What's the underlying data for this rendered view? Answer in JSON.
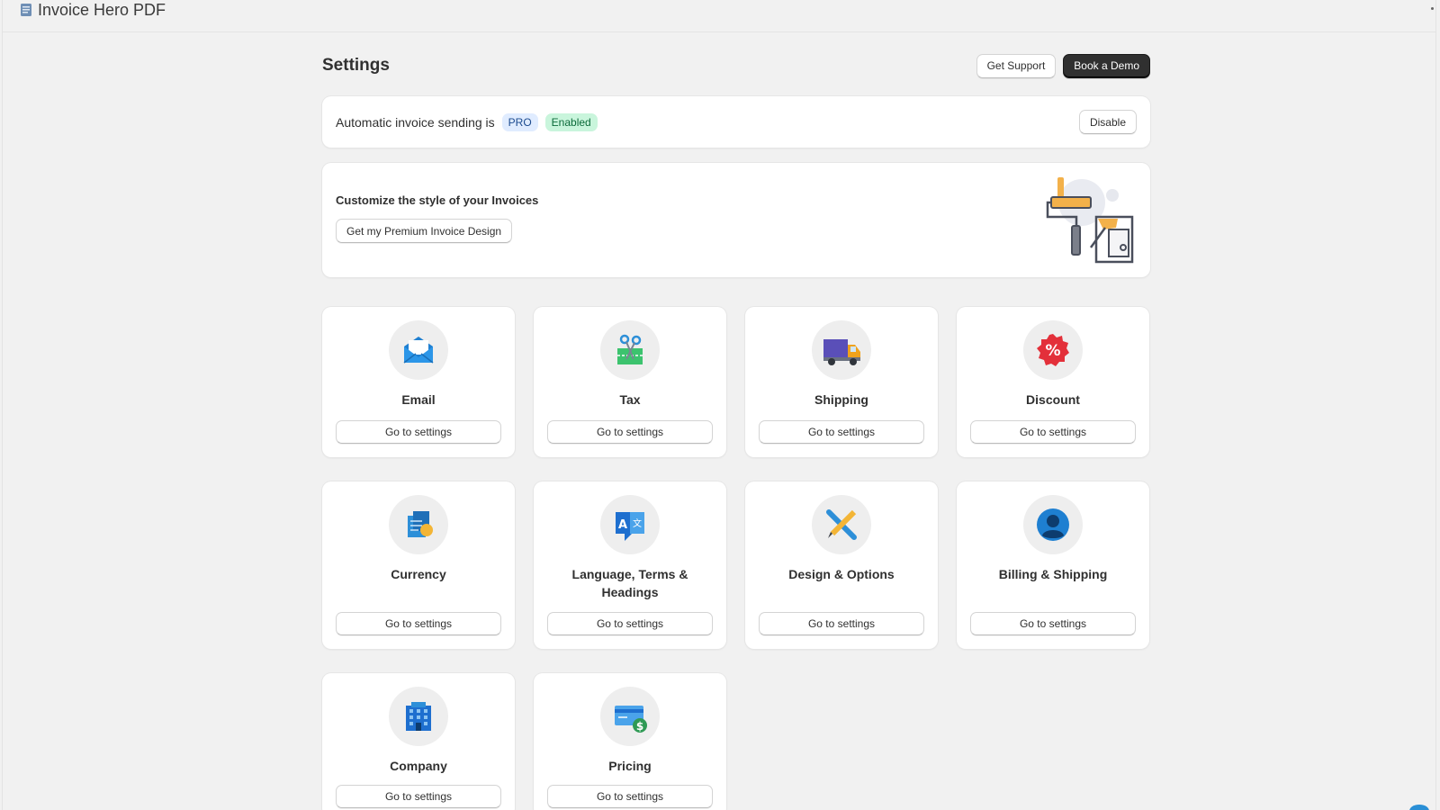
{
  "app": {
    "title": "Invoice Hero PDF"
  },
  "header": {
    "title": "Settings",
    "support_label": "Get Support",
    "demo_label": "Book a Demo"
  },
  "auto_sending": {
    "text": "Automatic invoice sending is",
    "badge_pro": "PRO",
    "badge_status": "Enabled",
    "action_label": "Disable"
  },
  "customize": {
    "title": "Customize the style of your Invoices",
    "button_label": "Get my Premium Invoice Design"
  },
  "tiles": [
    {
      "label": "Email",
      "icon": "email-icon",
      "button": "Go to settings"
    },
    {
      "label": "Tax",
      "icon": "scissors-icon",
      "button": "Go to settings"
    },
    {
      "label": "Shipping",
      "icon": "truck-icon",
      "button": "Go to settings"
    },
    {
      "label": "Discount",
      "icon": "percent-icon",
      "button": "Go to settings"
    },
    {
      "label": "Currency",
      "icon": "currency-icon",
      "button": "Go to settings"
    },
    {
      "label": "Language, Terms & Headings",
      "icon": "translate-icon",
      "button": "Go to settings"
    },
    {
      "label": "Design & Options",
      "icon": "design-tools-icon",
      "button": "Go to settings"
    },
    {
      "label": "Billing & Shipping",
      "icon": "user-icon",
      "button": "Go to settings"
    },
    {
      "label": "Company",
      "icon": "building-icon",
      "button": "Go to settings"
    },
    {
      "label": "Pricing",
      "icon": "card-dollar-icon",
      "button": "Go to settings"
    }
  ],
  "colors": {
    "accent_dark": "#303030",
    "pro_badge": "#e0ecff",
    "enabled_badge": "#c9f5dc"
  }
}
